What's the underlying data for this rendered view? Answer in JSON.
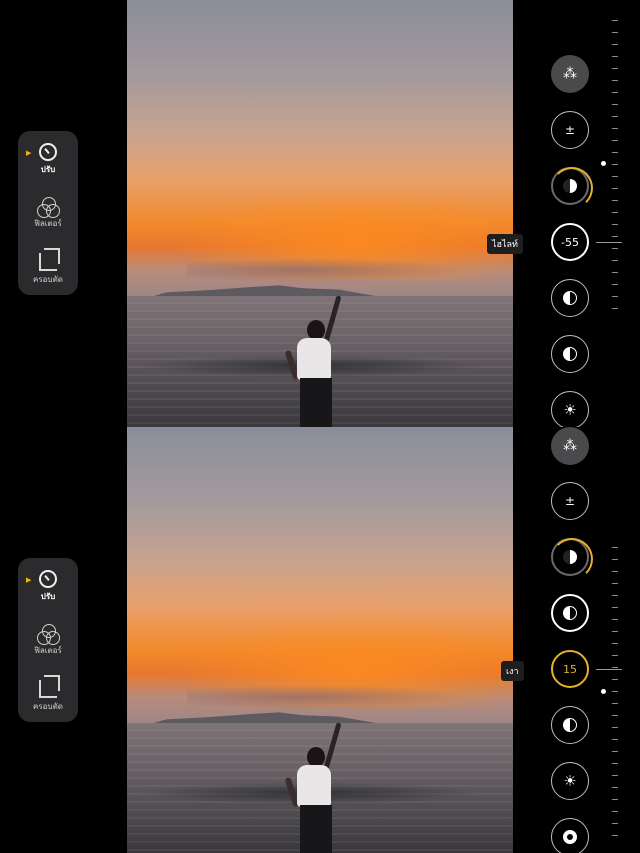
{
  "panels": [
    {
      "tools": [
        {
          "label": "ปรับ",
          "icon": "adjust-dial-icon",
          "active": true
        },
        {
          "label": "ฟิลเตอร์",
          "icon": "filters-icon",
          "active": false
        },
        {
          "label": "ครอบตัด",
          "icon": "crop-icon",
          "active": false
        }
      ],
      "adjustments": {
        "selected_label": "ไฮไลท์",
        "selected_value": "-55"
      }
    },
    {
      "tools": [
        {
          "label": "ปรับ",
          "icon": "adjust-dial-icon",
          "active": true
        },
        {
          "label": "ฟิลเตอร์",
          "icon": "filters-icon",
          "active": false
        },
        {
          "label": "ครอบตัด",
          "icon": "crop-icon",
          "active": false
        }
      ],
      "adjustments": {
        "selected_label": "เงา",
        "selected_value": "15"
      }
    }
  ],
  "icons": {
    "auto": "magic-wand-icon",
    "exposure": "exposure-face-icon",
    "brilliance": "brilliance-icon",
    "contrast": "contrast-half-circle-icon",
    "brightness": "brightness-sun-icon",
    "black_point": "black-point-icon"
  },
  "colors": {
    "accent": "#e6b128",
    "menu_bg": "#2b2b2d",
    "background": "#000000"
  }
}
